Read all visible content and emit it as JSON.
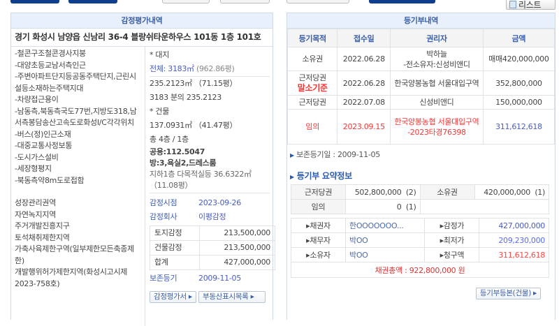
{
  "top": {
    "list_button": "리스트"
  },
  "appraisal": {
    "title": "감정평가내역",
    "address": "경기 화성시 남양읍 신남리 36-4 블랑쉬타운하우스 101동 1층 101호",
    "description": [
      "-철콘구조철콘경사지붕",
      "-대양초등교남서측인근",
      "-주변아파트단지등공동주택단지,근린시설등소재하는주택지대",
      "-차량접근용이",
      "-남동측,북동측국도77번,지방도318,남서측봉담송산고속도로화성I/C각각위치",
      "-버스(정)인근소재",
      "-대중교통사정보통",
      "-도시가스설비",
      "-세장형평지",
      "-북동측약8m도로접함"
    ],
    "zoning": [
      "성장관리권역",
      "자연녹지지역",
      "주거개발진흥지구",
      "토석채취제한지역",
      "가축사육제한구역(일부제한모든축종제한)",
      "개발행위허가제한지역(화성시고시제2023-758호)"
    ],
    "land_label": "* 대지",
    "land_total": "전체: 3183㎡",
    "land_total_pyeong": "(962.86평)",
    "land_share": "235.2123㎡ （71.15평）",
    "land_ratio": "3183 분의 235.2123",
    "building_label": "* 건물",
    "building_area": "137.0931㎡ （41.47평）",
    "floors": "총 4층 / 1층",
    "common_area": "공용:112.5047",
    "rooms": "방:3,욕실2,드레스룸",
    "basement": "지하1층 다목적실등 36.6322㎡ （11.08평）",
    "date_label": "감정시점",
    "date": "2023-09-26",
    "company_label": "감정회사",
    "company": "이평감정",
    "values": [
      {
        "label": "토지감정",
        "value": "213,500,000"
      },
      {
        "label": "건물감정",
        "value": "213,500,000"
      },
      {
        "label": "합계",
        "value": "427,000,000"
      }
    ],
    "preservation_label": "보존등기",
    "preservation_date": "2009-11-05",
    "buttons": [
      "감정평가서 ▸",
      "부동산표시목록 ▸"
    ]
  },
  "registry": {
    "title": "등기부내역",
    "columns": [
      "등기목적",
      "접수일",
      "권리자",
      "금액"
    ],
    "rows": [
      {
        "purpose": "소유권",
        "note": "",
        "date": "2022.06.28",
        "holder": "박하늘\n-전소유자:신성비앤디",
        "amount": "매매420,000,000",
        "highlight": false
      },
      {
        "purpose": "근저당권",
        "note": "말소기준",
        "date": "2022.06.28",
        "holder": "한국양봉농협 서울대입구역",
        "amount": "352,800,000",
        "highlight": false
      },
      {
        "purpose": "근저당권",
        "note": "",
        "date": "2022.07.08",
        "holder": "신성비앤디",
        "amount": "150,000,000",
        "highlight": false
      },
      {
        "purpose": "임의",
        "note": "",
        "date": "2023.09.15",
        "holder": "한국양봉농협 서울대입구역\n-2023타경76398",
        "amount": "311,612,618",
        "highlight": true
      }
    ],
    "preservation": "보존등기일 : 2009-11-05",
    "summary_title": "등기부 요약정보",
    "summary": [
      [
        {
          "k": "근저당권",
          "v": "502,800,000",
          "c": "(2)"
        },
        {
          "k": "소유권",
          "v": "420,000,000",
          "c": "(1)"
        }
      ],
      [
        {
          "k": "임의",
          "v": "0",
          "c": "(1)"
        }
      ]
    ],
    "parties": [
      {
        "k": "▸채권자",
        "v": "한OOOOOOO...",
        "k2": "▸감정가",
        "v2": "427,000,000"
      },
      {
        "k": "▸채무자",
        "v": "박OO",
        "k2": "▸최저가",
        "v2": "209,230,000"
      },
      {
        "k": "▸소유자",
        "v": "박OO",
        "k2": "▸청구액",
        "v2": "311,612,618"
      }
    ],
    "total": "채권총액 : 922,800,000 원",
    "copy_button": "등기부등본(건물) ▸"
  }
}
